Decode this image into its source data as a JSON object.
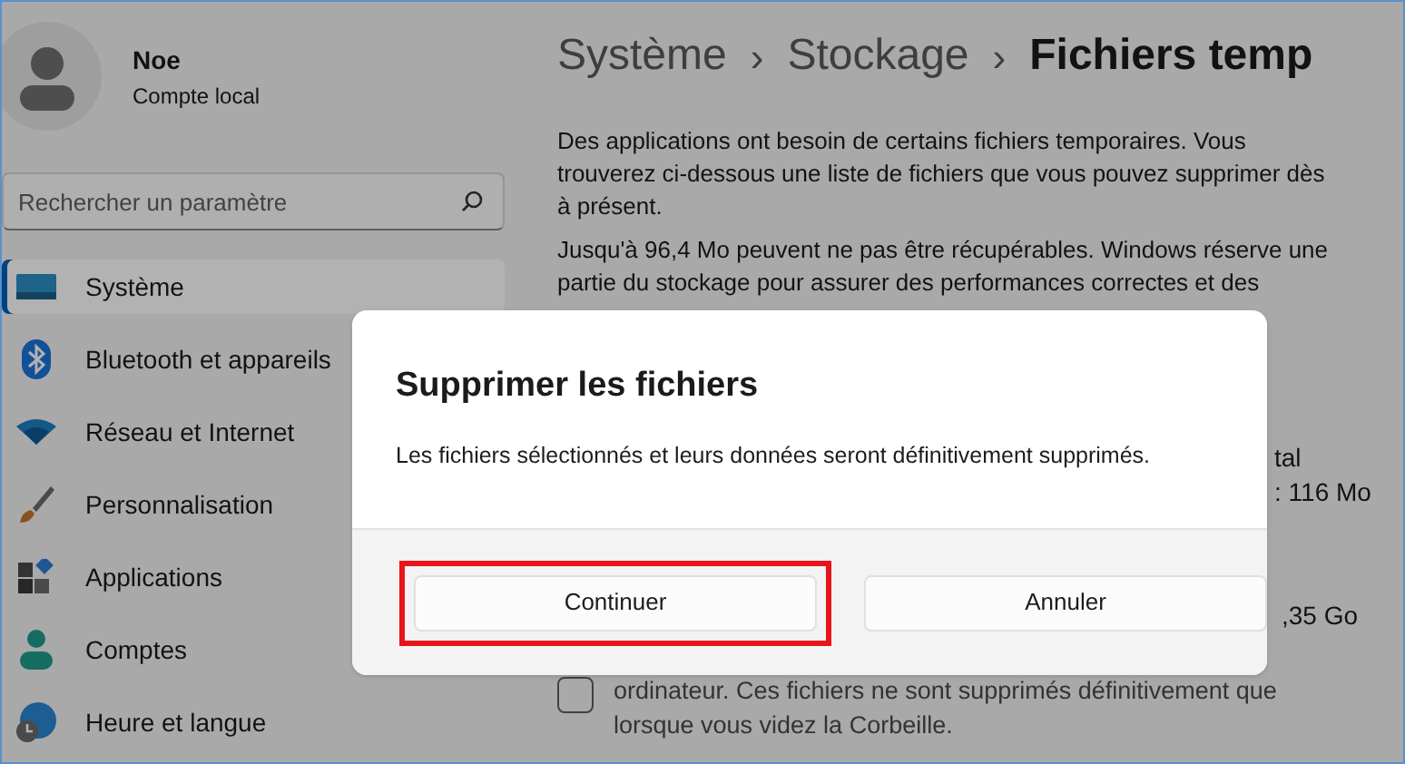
{
  "account": {
    "name": "Noe",
    "type": "Compte local"
  },
  "search": {
    "placeholder": "Rechercher un paramètre"
  },
  "nav": [
    {
      "label": "Système",
      "kind": "system",
      "selected": true
    },
    {
      "label": "Bluetooth et appareils",
      "kind": "bluetooth",
      "selected": false
    },
    {
      "label": "Réseau et Internet",
      "kind": "wifi",
      "selected": false
    },
    {
      "label": "Personnalisation",
      "kind": "brush",
      "selected": false
    },
    {
      "label": "Applications",
      "kind": "apps",
      "selected": false
    },
    {
      "label": "Comptes",
      "kind": "person",
      "selected": false
    },
    {
      "label": "Heure et langue",
      "kind": "globe",
      "selected": false
    }
  ],
  "breadcrumb": [
    {
      "label": "Système",
      "current": false
    },
    {
      "label": "Stockage",
      "current": false
    },
    {
      "label": "Fichiers temp",
      "current": true
    }
  ],
  "breadcrumb_separator": "›",
  "paragraphs": [
    "Des applications ont besoin de certains fichiers temporaires. Vous trouverez ci-dessous une liste de fichiers que vous pouvez supprimer dès à présent.",
    "Jusqu'à 96,4 Mo peuvent ne pas être récupérables. Windows réserve une partie du stockage pour assurer des performances correctes et des"
  ],
  "fragments": [
    "tal",
    ": 116 Mo",
    ",35 Go"
  ],
  "recycle_item": {
    "checked": false,
    "lines": [
      "ordinateur. Ces fichiers ne sont supprimés définitivement que",
      "lorsque vous videz la Corbeille."
    ]
  },
  "dialog": {
    "title": "Supprimer les fichiers",
    "message": "Les fichiers sélectionnés et leurs données seront définitivement supprimés.",
    "buttons": [
      {
        "label": "Continuer",
        "highlighted": true
      },
      {
        "label": "Annuler",
        "highlighted": false
      }
    ]
  }
}
